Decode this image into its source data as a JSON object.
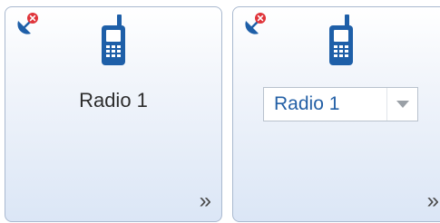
{
  "tiles": [
    {
      "label": "Radio 1",
      "status_icon": "satellite-dish-error-icon",
      "device_icon": "mobile-radio-icon",
      "more_icon": "double-chevron-right-icon",
      "more_glyph": "»"
    },
    {
      "select_value": "Radio 1",
      "status_icon": "satellite-dish-error-icon",
      "device_icon": "mobile-radio-icon",
      "more_icon": "double-chevron-right-icon",
      "more_glyph": "»"
    }
  ],
  "colors": {
    "icon_blue": "#1e5fa8",
    "error_red": "#e0353b",
    "tile_border": "#a9b9cf",
    "select_text": "#2460a6"
  }
}
